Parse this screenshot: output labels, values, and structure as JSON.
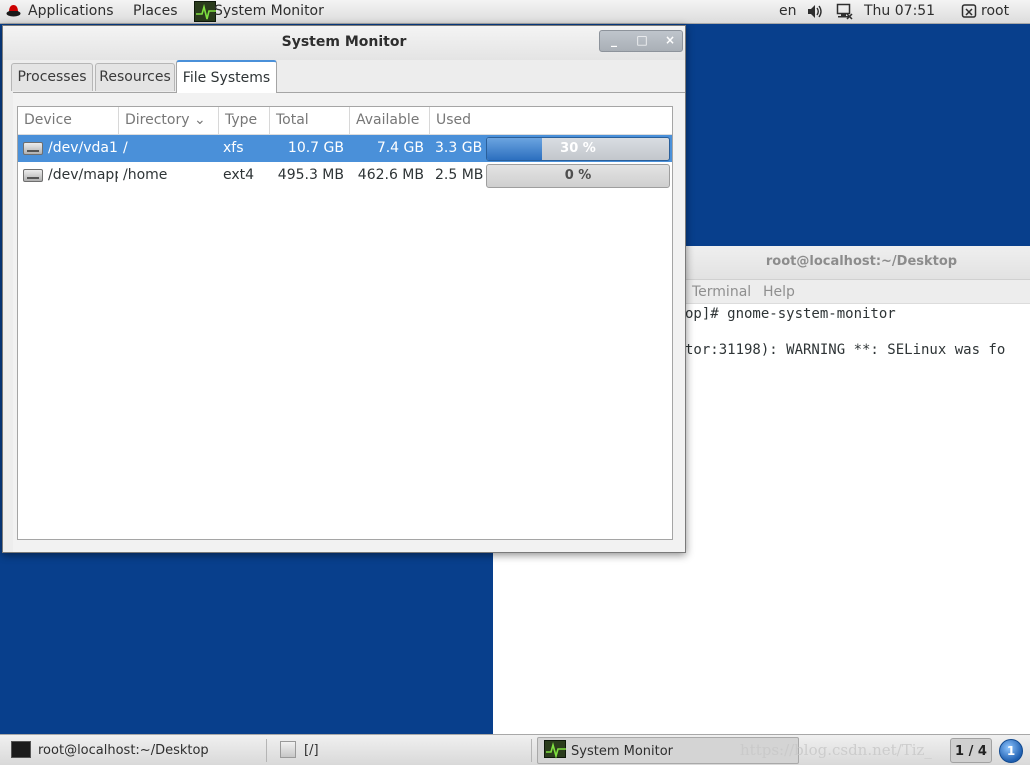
{
  "top_panel": {
    "applications": "Applications",
    "places": "Places",
    "active_app": "System Monitor",
    "language": "en",
    "clock": "Thu 07:51",
    "user": "root"
  },
  "terminal": {
    "title": "root@localhost:~/Desktop",
    "menus": [
      "Terminal",
      "Help"
    ],
    "lines": [
      "op]# gnome-system-monitor",
      "tor:31198): WARNING **: SELinux was fo"
    ]
  },
  "system_monitor": {
    "title": "System Monitor",
    "window_buttons": {
      "minimize": "_",
      "maximize": "□",
      "close": "×"
    },
    "tabs": [
      {
        "label": "Processes"
      },
      {
        "label": "Resources"
      },
      {
        "label": "File Systems"
      }
    ],
    "active_tab": "File Systems",
    "columns": [
      "Device",
      "Directory",
      "Type",
      "Total",
      "Available",
      "Used"
    ],
    "sort_indicator": "⌄",
    "rows": [
      {
        "device": "/dev/vda1",
        "directory": "/",
        "type": "xfs",
        "total": "10.7 GB",
        "available": "7.4 GB",
        "used": "3.3 GB",
        "percent_label": "30 %",
        "percent": 30,
        "selected": true
      },
      {
        "device": "/dev/mapp",
        "directory": "/home",
        "type": "ext4",
        "total": "495.3 MB",
        "available": "462.6 MB",
        "used": "2.5 MB",
        "percent_label": "0 %",
        "percent": 0,
        "selected": false
      }
    ]
  },
  "bottom_panel": {
    "tasks": [
      {
        "label": "root@localhost:~/Desktop"
      },
      {
        "label": "[/]"
      },
      {
        "label": "System Monitor"
      }
    ],
    "watermark": "https://blog.csdn.net/Tiz_",
    "workspace": "1 / 4",
    "workspace_badge": "1"
  }
}
